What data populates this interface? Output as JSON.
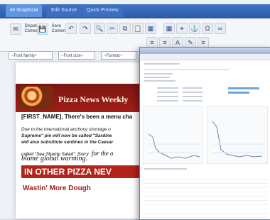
{
  "tabs": [
    {
      "label": "ite Graphical",
      "active": true
    },
    {
      "label": "Edit Source",
      "active": false
    },
    {
      "label": "Quick Preview",
      "active": false
    }
  ],
  "toolbar": {
    "dispatch_line1": "Dispatch",
    "dispatch_line2": "Content",
    "save_line1": "Save",
    "save_line2": "Content",
    "icons": [
      "undo-icon",
      "redo-icon",
      "find-icon",
      "cut-icon",
      "copy-icon",
      "paste-icon",
      "image-icon",
      "table-icon",
      "link-icon",
      "anchor-icon",
      "omega-icon",
      "special-char-icon",
      "align-left-icon",
      "align-center-icon",
      "align-right-icon",
      "justify-icon",
      "font-color-icon",
      "highlight-icon"
    ]
  },
  "font_controls": {
    "family": "~Font family~",
    "size": "~Font size~",
    "format": "~Format~"
  },
  "newsletter": {
    "title": "Pizza News Weekly",
    "greeting": "[FIRST_NAME], There's been a menu cha",
    "body_line1": "Due to the international anchovy shortage o",
    "body_line2": "Supreme\" pie will now be called \"Sardine",
    "body_line3": "will also substitute sardines in the Caesar",
    "body_line4": "called \"Sea Shanty Salad\". Sorry",
    "body_tail": "for the o",
    "body_line5": "blame global warming.",
    "section_title": "IN OTHER PIZZA NEV",
    "subheading": "Wastin' More Dough"
  },
  "colors": {
    "accent_blue": "#2d5aa6",
    "masthead_red": "#a11e17",
    "chart_blue": "#6ea7d8"
  }
}
